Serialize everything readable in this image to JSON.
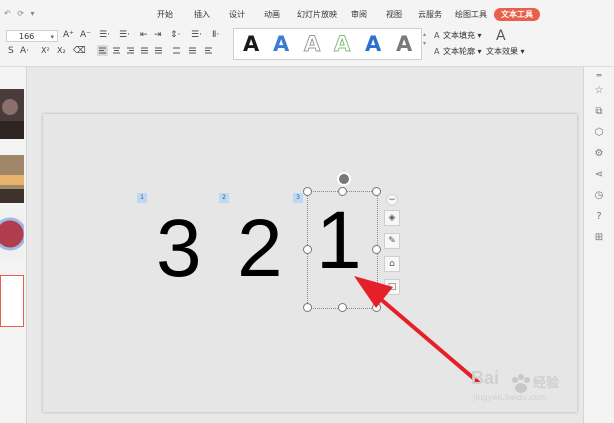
{
  "quick_access": "↶ ⟳ ▾",
  "ribbon_tabs": [
    {
      "label": "开始",
      "active": false
    },
    {
      "label": "插入",
      "active": false
    },
    {
      "label": "设计",
      "active": false
    },
    {
      "label": "动画",
      "active": false
    },
    {
      "label": "幻灯片放映",
      "active": false
    },
    {
      "label": "审阅",
      "active": false
    },
    {
      "label": "视图",
      "active": false
    },
    {
      "label": "云服务",
      "active": false
    },
    {
      "label": "绘图工具",
      "active": false
    },
    {
      "label": "文本工具",
      "active": true
    }
  ],
  "font_size": "166",
  "font_buttons": {
    "grow": "A⁺",
    "shrink": "A⁻",
    "bullets": "☰·",
    "numbering": "☰·",
    "indent_dec": "⇤",
    "indent_inc": "⇥",
    "line_spacing": "⇕·",
    "para": "☰·",
    "direction": "Ⅱ·",
    "font_s": "S",
    "font_color": "A·",
    "superscript": "X²",
    "subscript": "X₂",
    "clear": "⌫"
  },
  "word_art_styles": [
    {
      "letter": "A",
      "color": "#1a1a1a",
      "style": "solid"
    },
    {
      "letter": "A",
      "color": "#3a7bd5",
      "style": "solid"
    },
    {
      "letter": "A",
      "color": "#9a9a9a",
      "style": "outline"
    },
    {
      "letter": "A",
      "color": "#7fbf7f",
      "style": "outline"
    },
    {
      "letter": "A",
      "color": "#2f6fd0",
      "style": "solid"
    },
    {
      "letter": "A",
      "color": "#7a7a7a",
      "style": "solid"
    }
  ],
  "text_format": {
    "fill": "文本填充",
    "outline": "文本轮廓",
    "effects": "文本效果"
  },
  "slide": {
    "numbers": [
      {
        "tag": "1",
        "value": "3"
      },
      {
        "tag": "2",
        "value": "2"
      },
      {
        "tag": "3",
        "value": "1"
      }
    ]
  },
  "watermark": {
    "brand": "Bai",
    "brand_cn": "经验",
    "url": "jingyan.baidu.com"
  },
  "colors": {
    "accent": "#e8604c",
    "arrow": "#e5202a",
    "tag_bg": "#bfd8f3"
  },
  "right_icons": [
    "star-icon",
    "copy-icon",
    "shape-icon",
    "settings-icon",
    "share-icon",
    "history-icon",
    "help-icon",
    "grid-icon"
  ],
  "float_tools": [
    "collapse-icon",
    "layers-icon",
    "pen-icon",
    "fill-icon",
    "border-icon"
  ]
}
